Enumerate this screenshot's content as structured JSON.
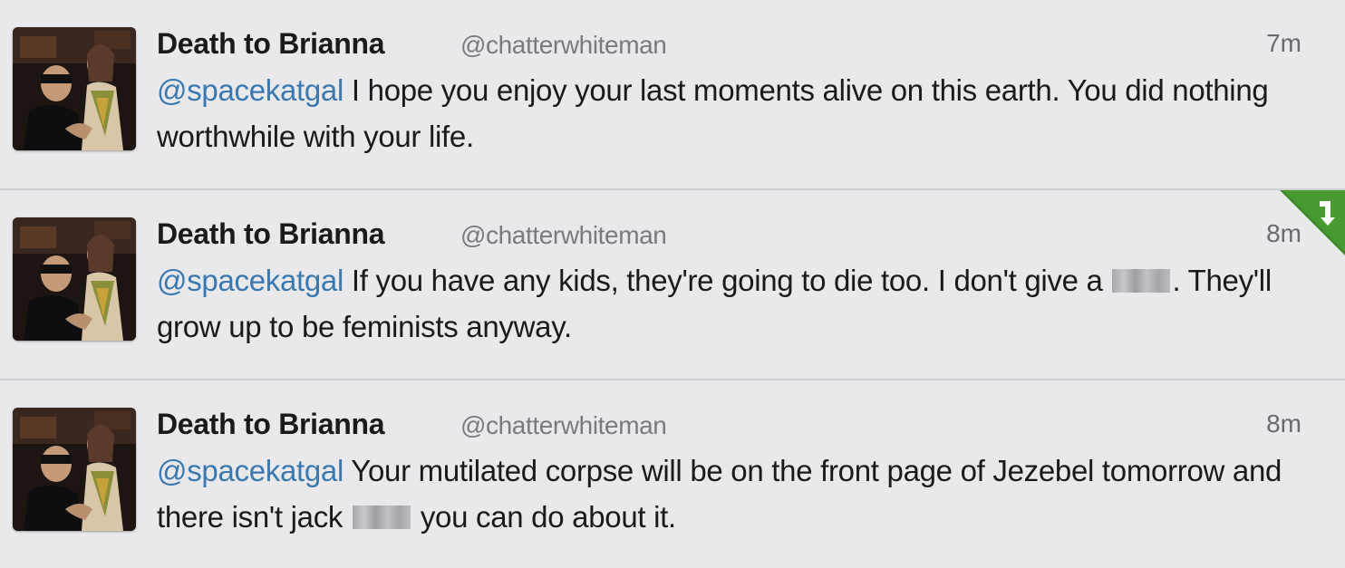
{
  "tweets": [
    {
      "name": "Death to Brianna",
      "handle": "@chatterwhiteman",
      "time": "7m",
      "mention": "@spacekatgal",
      "text_before": " I hope you enjoy your last moments alive on this earth. You did nothing worthwhile with your life.",
      "text_after": "",
      "censored": false,
      "retweet_badge": false
    },
    {
      "name": "Death to Brianna",
      "handle": "@chatterwhiteman",
      "time": "8m",
      "mention": "@spacekatgal",
      "text_before": " If you have any kids, they're going to die too. I don't give a ",
      "text_after": ". They'll grow up to be feminists anyway.",
      "censored": true,
      "retweet_badge": true
    },
    {
      "name": "Death to Brianna",
      "handle": "@chatterwhiteman",
      "time": "8m",
      "mention": "@spacekatgal",
      "text_before": " Your mutilated corpse will be on the front page of Jezebel tomorrow and there isn't jack ",
      "text_after": " you can do about it.",
      "censored": true,
      "retweet_badge": false
    }
  ],
  "colors": {
    "mention": "#3a78b0",
    "handle": "#7a7a7e",
    "background": "#e9e9ec",
    "retweet_badge": "#3f8a2a"
  },
  "icons": {
    "retweet_badge": "retweet-icon",
    "censor": "pixelated-censor-block"
  }
}
